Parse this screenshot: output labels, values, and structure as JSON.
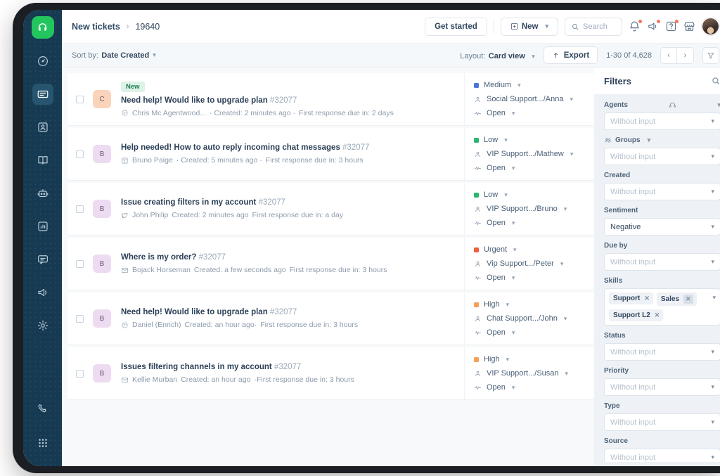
{
  "header": {
    "breadcrumb_root": "New tickets",
    "breadcrumb_sep": "›",
    "breadcrumb_id": "19640",
    "get_started": "Get started",
    "new_button": "New",
    "search_placeholder": "Search",
    "icons": [
      "bell-icon",
      "announcement-icon",
      "help-icon",
      "marketplace-icon",
      "avatar"
    ]
  },
  "toolbar": {
    "sort_prefix": "Sort by:",
    "sort_value": "Date Created",
    "layout_prefix": "Layout:",
    "layout_value": "Card view",
    "export_label": "Export",
    "page_count": "1-30 0f 4,628",
    "prev": "‹",
    "next": "›"
  },
  "sidebar": {
    "items": [
      {
        "name": "dashboard",
        "icon": "gauge-icon",
        "active": false
      },
      {
        "name": "tickets",
        "icon": "ticket-icon",
        "active": true
      },
      {
        "name": "contacts",
        "icon": "contact-card-icon",
        "active": false
      },
      {
        "name": "knowledge-base",
        "icon": "book-icon",
        "active": false
      },
      {
        "name": "automation",
        "icon": "robot-icon",
        "active": false
      },
      {
        "name": "analytics",
        "icon": "chart-icon",
        "active": false
      },
      {
        "name": "chat",
        "icon": "chat-icon",
        "active": false
      },
      {
        "name": "campaigns",
        "icon": "megaphone-icon",
        "active": false
      },
      {
        "name": "settings",
        "icon": "gear-icon",
        "active": false
      }
    ],
    "bottom_items": [
      {
        "name": "phone",
        "icon": "phone-icon"
      },
      {
        "name": "dialpad",
        "icon": "dialpad-icon"
      }
    ]
  },
  "tickets": [
    {
      "badge": "New",
      "avatar_letter": "C",
      "avatar_bg": "#f9d4bb",
      "title": "Need help! Would like to upgrade plan",
      "id": "#32077",
      "channel_icon": "chat-bubble-icon",
      "requester": "Chris Mc Agentwood...",
      "created": "· Created: 2 minutes ago ·",
      "due": "First response due in: 2 days",
      "priority": "Medium",
      "priority_color": "#4f74d8",
      "group": "Social Support.../Anna",
      "status": "Open"
    },
    {
      "badge": "",
      "avatar_letter": "B",
      "avatar_bg": "#eddbf2",
      "title": "Help needed! How to auto reply incoming chat messages",
      "id": "#32077",
      "channel_icon": "form-icon",
      "requester": "Bruno Paige",
      "created": "· Created: 5 minutes ago ·",
      "due": "First response due in: 3 hours",
      "priority": "Low",
      "priority_color": "#2bb673",
      "group": "VIP Support.../Mathew",
      "status": "Open"
    },
    {
      "badge": "",
      "avatar_letter": "B",
      "avatar_bg": "#eddbf2",
      "title": "Issue creating filters in my account",
      "id": "#32077",
      "channel_icon": "twitter-icon",
      "requester": "John Philip",
      "created": "Created: 2 minutes ago",
      "due": "First response due in: a day",
      "priority": "Low",
      "priority_color": "#2bb673",
      "group": "VIP Support.../Bruno",
      "status": "Open"
    },
    {
      "badge": "",
      "avatar_letter": "B",
      "avatar_bg": "#eddbf2",
      "title": "Where is my order?",
      "id": "#32077",
      "channel_icon": "email-icon",
      "requester": "Bojack Horseman",
      "created": "Created: a few seconds ago",
      "due": "First response due in: 3 hours",
      "priority": "Urgent",
      "priority_color": "#ef5d42",
      "group": "Vip Support.../Peter",
      "status": "Open"
    },
    {
      "badge": "",
      "avatar_letter": "B",
      "avatar_bg": "#eddbf2",
      "title": "Need help! Would like to upgrade plan",
      "id": "#32077",
      "channel_icon": "chat-bubble-icon",
      "requester": "Daniel (Enrich)",
      "created": "Created: an hour ago·",
      "due": "First response due in: 3 hours",
      "priority": "High",
      "priority_color": "#f5a05a",
      "group": "Chat Support.../John",
      "status": "Open"
    },
    {
      "badge": "",
      "avatar_letter": "B",
      "avatar_bg": "#eddbf2",
      "title": "Issues filtering channels in my account",
      "id": "#32077",
      "channel_icon": "email-icon",
      "requester": "Kellie Murban",
      "created": "Created: an hour ago",
      "due": "·First response due in: 3 hours",
      "priority": "High",
      "priority_color": "#f5a05a",
      "group": "VIP Support.../Susan",
      "status": "Open"
    }
  ],
  "filters": {
    "title": "Filters",
    "search_icon": "search-icon",
    "groups": [
      {
        "label": "Agents",
        "icon": "headset-icon",
        "trailing_caret": true,
        "type": "select",
        "value": "",
        "placeholder": "Without input"
      },
      {
        "label": "Groups",
        "icon": "people-icon",
        "label_caret": true,
        "type": "select",
        "value": "",
        "placeholder": "Without input"
      },
      {
        "label": "Created",
        "type": "select",
        "value": "",
        "placeholder": "Without input"
      },
      {
        "label": "Sentiment",
        "type": "select",
        "value": "Negative",
        "placeholder": "Without input"
      },
      {
        "label": "Due by",
        "type": "select",
        "value": "",
        "placeholder": "Without input"
      },
      {
        "label": "Skills",
        "type": "chips",
        "chips": [
          "Support",
          "Sales",
          "Support L2"
        ]
      },
      {
        "label": "Status",
        "type": "select",
        "value": "",
        "placeholder": "Without input"
      },
      {
        "label": "Priority",
        "type": "select",
        "value": "",
        "placeholder": "Without input"
      },
      {
        "label": "Type",
        "type": "select",
        "value": "",
        "placeholder": "Without input"
      },
      {
        "label": "Source",
        "type": "select",
        "value": "",
        "placeholder": "Without input"
      }
    ]
  },
  "colors": {
    "rail_bg": "#163a52",
    "brand_green": "#22c55e",
    "panel_bg": "#eef2f6",
    "page_bg": "#f7f9fb"
  }
}
